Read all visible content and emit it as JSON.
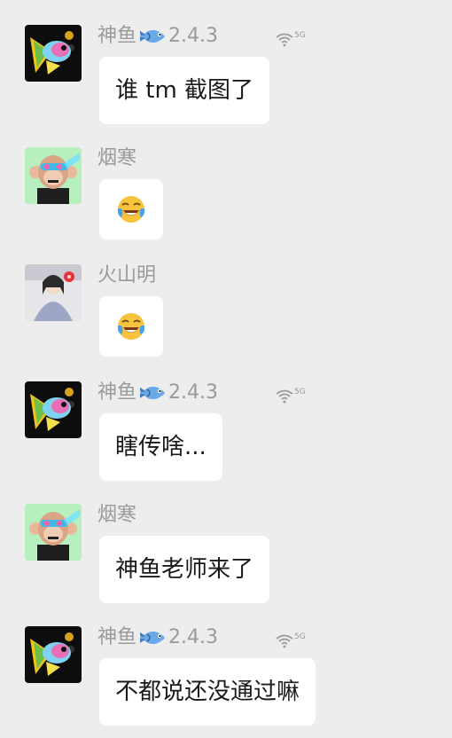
{
  "messages": [
    {
      "sender": "神鱼",
      "badge_icon": "fish-icon",
      "version": "2.4.3",
      "network": "5G",
      "text": "谁 tm 截图了",
      "avatar": "fish-avatar"
    },
    {
      "sender": "烟寒",
      "emoji": "laughing-crying-emoji",
      "avatar": "monkey-avatar"
    },
    {
      "sender": "火山明",
      "emoji": "laughing-crying-emoji",
      "avatar": "portrait-avatar"
    },
    {
      "sender": "神鱼",
      "badge_icon": "fish-icon",
      "version": "2.4.3",
      "network": "5G",
      "text": "瞎传啥...",
      "avatar": "fish-avatar"
    },
    {
      "sender": "烟寒",
      "text": "神鱼老师来了",
      "avatar": "monkey-avatar"
    },
    {
      "sender": "神鱼",
      "badge_icon": "fish-icon",
      "version": "2.4.3",
      "network": "5G",
      "text": "不都说还没通过嘛",
      "avatar": "fish-avatar"
    }
  ],
  "colors": {
    "background": "#ededed",
    "bubble": "#ffffff",
    "nickname": "#9a9a9a",
    "text": "#1a1a1a"
  }
}
